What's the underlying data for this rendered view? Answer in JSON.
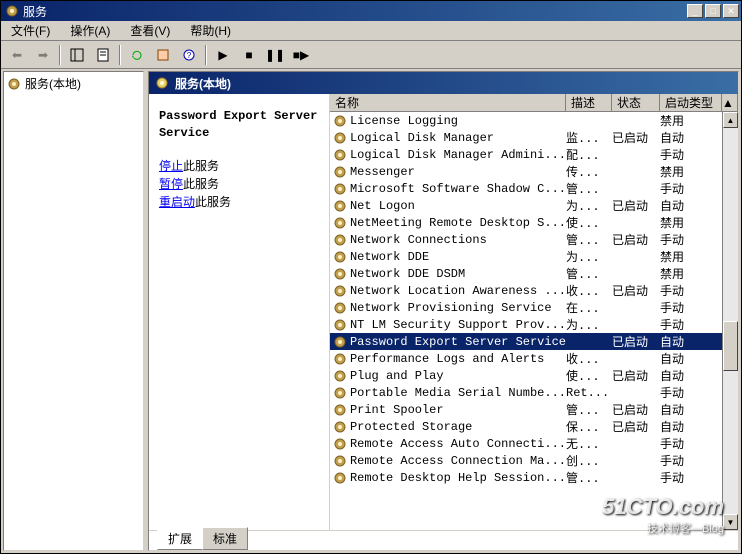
{
  "window": {
    "title": "服务"
  },
  "menus": {
    "file": "文件(F)",
    "action": "操作(A)",
    "view": "查看(V)",
    "help": "帮助(H)"
  },
  "tree": {
    "root": "服务(本地)"
  },
  "panel": {
    "header": "服务(本地)"
  },
  "selected": {
    "name": "Password Export Server Service",
    "links": {
      "stop": {
        "a": "停止",
        "b": "此服务"
      },
      "pause": {
        "a": "暂停",
        "b": "此服务"
      },
      "restart": {
        "a": "重启动",
        "b": "此服务"
      }
    }
  },
  "columns": {
    "name": "名称",
    "desc": "描述",
    "status": "状态",
    "startup": "启动类型"
  },
  "tabs": {
    "extended": "扩展",
    "standard": "标准"
  },
  "services": [
    {
      "name": "License Logging",
      "desc": "",
      "status": "",
      "startup": "禁用"
    },
    {
      "name": "Logical Disk Manager",
      "desc": "监...",
      "status": "已启动",
      "startup": "自动"
    },
    {
      "name": "Logical Disk Manager Admini...",
      "desc": "配...",
      "status": "",
      "startup": "手动"
    },
    {
      "name": "Messenger",
      "desc": "传...",
      "status": "",
      "startup": "禁用"
    },
    {
      "name": "Microsoft Software Shadow C...",
      "desc": "管...",
      "status": "",
      "startup": "手动"
    },
    {
      "name": "Net Logon",
      "desc": "为...",
      "status": "已启动",
      "startup": "自动"
    },
    {
      "name": "NetMeeting Remote Desktop S...",
      "desc": "使...",
      "status": "",
      "startup": "禁用"
    },
    {
      "name": "Network Connections",
      "desc": "管...",
      "status": "已启动",
      "startup": "手动"
    },
    {
      "name": "Network DDE",
      "desc": "为...",
      "status": "",
      "startup": "禁用"
    },
    {
      "name": "Network DDE DSDM",
      "desc": "管...",
      "status": "",
      "startup": "禁用"
    },
    {
      "name": "Network Location Awareness ...",
      "desc": "收...",
      "status": "已启动",
      "startup": "手动"
    },
    {
      "name": "Network Provisioning Service",
      "desc": "在...",
      "status": "",
      "startup": "手动"
    },
    {
      "name": "NT LM Security Support Prov...",
      "desc": "为...",
      "status": "",
      "startup": "手动"
    },
    {
      "name": "Password Export Server Service",
      "desc": "",
      "status": "已启动",
      "startup": "自动",
      "selected": true
    },
    {
      "name": "Performance Logs and Alerts",
      "desc": "收...",
      "status": "",
      "startup": "自动"
    },
    {
      "name": "Plug and Play",
      "desc": "使...",
      "status": "已启动",
      "startup": "自动"
    },
    {
      "name": "Portable Media Serial Numbe...",
      "desc": "Ret...",
      "status": "",
      "startup": "手动"
    },
    {
      "name": "Print Spooler",
      "desc": "管...",
      "status": "已启动",
      "startup": "自动"
    },
    {
      "name": "Protected Storage",
      "desc": "保...",
      "status": "已启动",
      "startup": "自动"
    },
    {
      "name": "Remote Access Auto Connecti...",
      "desc": "无...",
      "status": "",
      "startup": "手动"
    },
    {
      "name": "Remote Access Connection Ma...",
      "desc": "创...",
      "status": "",
      "startup": "手动"
    },
    {
      "name": "Remote Desktop Help Session...",
      "desc": "管...",
      "status": "",
      "startup": "手动"
    }
  ],
  "watermark": {
    "line1": "51CTO.com",
    "line2": "技术博客—Blog"
  }
}
